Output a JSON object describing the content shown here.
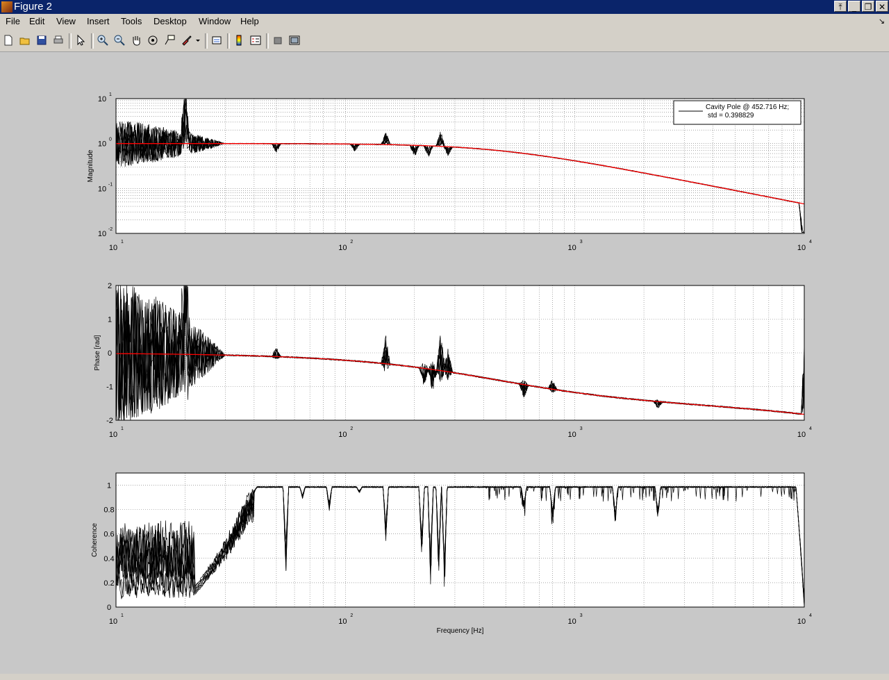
{
  "window": {
    "title": "Figure 2"
  },
  "menu": [
    "File",
    "Edit",
    "View",
    "Insert",
    "Tools",
    "Desktop",
    "Window",
    "Help"
  ],
  "toolbar_icons": [
    "new-figure-icon",
    "open-file-icon",
    "save-icon",
    "print-icon",
    "edit-plot-arrow-icon",
    "zoom-in-icon",
    "zoom-out-icon",
    "pan-hand-icon",
    "rotate-3d-icon",
    "data-cursor-icon",
    "brush-icon",
    "brush-dropdown-icon",
    "link-plot-icon",
    "insert-colorbar-icon",
    "insert-legend-icon",
    "hide-plot-tools-icon",
    "show-plot-tools-icon"
  ],
  "chart_data": [
    {
      "type": "line",
      "ylabel": "Magnitude",
      "xscale": "log",
      "yscale": "log",
      "xlim": [
        10,
        10000
      ],
      "ylim": [
        0.01,
        10
      ],
      "grid": true,
      "legend": {
        "text_line1": "Cavity Pole @ 452.716 Hz;",
        "text_line2": "std = 0.398829",
        "placement": "top-right"
      },
      "xtick_base": [
        "10",
        "10",
        "10",
        "10"
      ],
      "xtick_exp": [
        "1",
        "2",
        "3",
        "4"
      ],
      "ytick_base": [
        "10",
        "10",
        "10",
        "10"
      ],
      "ytick_exp": [
        "1",
        "0",
        "-1",
        "-2"
      ],
      "series": [
        {
          "color": "#ff0000",
          "pole_hz": 452.716,
          "dc_gain": 1.0,
          "high_freq_rolloff_hz": 9500
        },
        {
          "color": "#000000",
          "kind": "measured"
        }
      ]
    },
    {
      "type": "line",
      "ylabel": "Phase [rad]",
      "xscale": "log",
      "xlim": [
        10,
        10000
      ],
      "ylim": [
        -2,
        2
      ],
      "grid": true,
      "xtick_base": [
        "10",
        "10",
        "10",
        "10"
      ],
      "xtick_exp": [
        "1",
        "2",
        "3",
        "4"
      ],
      "yticks": [
        "2",
        "1",
        "0",
        "-1",
        "-2"
      ],
      "series": [
        {
          "color": "#ff0000",
          "pole_hz": 452.716,
          "phase_at_10k": -1.55
        },
        {
          "color": "#000000",
          "kind": "measured"
        }
      ]
    },
    {
      "type": "line",
      "ylabel": "Coherence",
      "xlabel": "Frequency [Hz]",
      "xscale": "log",
      "xlim": [
        10,
        10000
      ],
      "ylim": [
        0,
        1.1
      ],
      "grid": true,
      "xtick_base": [
        "10",
        "10",
        "10",
        "10"
      ],
      "xtick_exp": [
        "1",
        "2",
        "3",
        "4"
      ],
      "yticks": [
        "1",
        "0.8",
        "0.6",
        "0.4",
        "0.2",
        "0"
      ],
      "series": [
        {
          "color": "#000000",
          "kind": "measured",
          "plateau": 0.99,
          "dips_hz": [
            40,
            55,
            65,
            85,
            115,
            150,
            215,
            235,
            255,
            270,
            600,
            800,
            1500,
            2300
          ],
          "dip_depth": [
            0.05,
            0.75,
            0.1,
            0.2,
            0.05,
            0.45,
            0.6,
            0.85,
            0.75,
            0.95,
            0.2,
            0.3,
            0.3,
            0.3
          ],
          "rolloff_hz": 9200
        }
      ]
    }
  ]
}
